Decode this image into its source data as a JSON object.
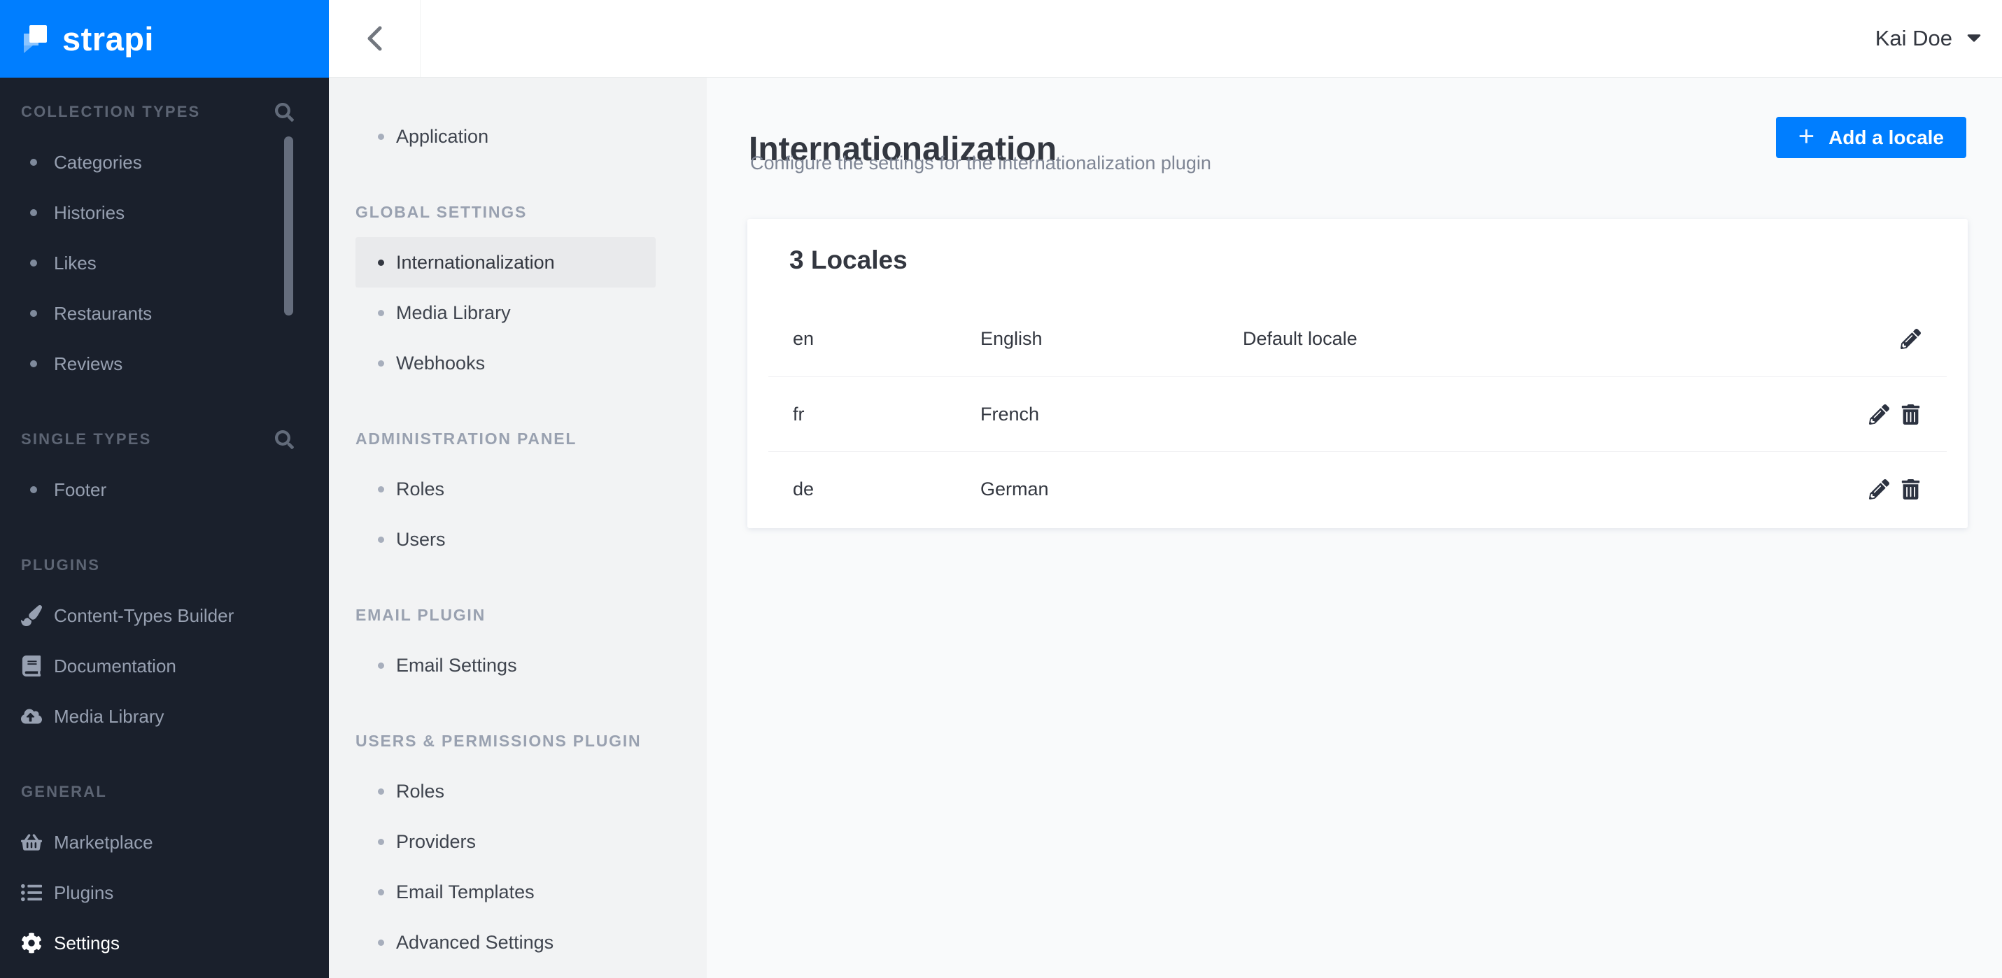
{
  "brand": {
    "name": "strapi"
  },
  "colors": {
    "accent": "#007eff",
    "sidebar_bg": "#1a202c",
    "subnav_bg": "#f2f3f4",
    "subnav_active_bg": "#e9eaec",
    "main_bg": "#f9fafb",
    "text_dark": "#333740",
    "text_muted": "#7e8594"
  },
  "sidebar": {
    "sections": [
      {
        "label": "COLLECTION TYPES",
        "icon": "search-icon",
        "items": [
          {
            "label": "Categories",
            "icon": "bullet"
          },
          {
            "label": "Histories",
            "icon": "bullet"
          },
          {
            "label": "Likes",
            "icon": "bullet"
          },
          {
            "label": "Restaurants",
            "icon": "bullet"
          },
          {
            "label": "Reviews",
            "icon": "bullet"
          }
        ]
      },
      {
        "label": "SINGLE TYPES",
        "icon": "search-icon",
        "items": [
          {
            "label": "Footer",
            "icon": "bullet"
          }
        ]
      },
      {
        "label": "PLUGINS",
        "items": [
          {
            "label": "Content-Types Builder",
            "icon": "paintbrush-icon"
          },
          {
            "label": "Documentation",
            "icon": "book-icon"
          },
          {
            "label": "Media Library",
            "icon": "cloud-upload-icon"
          }
        ]
      },
      {
        "label": "GENERAL",
        "items": [
          {
            "label": "Marketplace",
            "icon": "basket-icon"
          },
          {
            "label": "Plugins",
            "icon": "list-icon"
          },
          {
            "label": "Settings",
            "icon": "gear-icon",
            "active": true
          }
        ]
      }
    ]
  },
  "topbar": {
    "back_icon": "chevron-left-icon",
    "user": {
      "name": "Kai Doe",
      "menu_icon": "caret-down-icon"
    }
  },
  "subnav": {
    "standalone": [
      {
        "label": "Application"
      }
    ],
    "sections": [
      {
        "label": "GLOBAL SETTINGS",
        "items": [
          {
            "label": "Internationalization",
            "active": true
          },
          {
            "label": "Media Library"
          },
          {
            "label": "Webhooks"
          }
        ]
      },
      {
        "label": "ADMINISTRATION PANEL",
        "items": [
          {
            "label": "Roles"
          },
          {
            "label": "Users"
          }
        ]
      },
      {
        "label": "EMAIL PLUGIN",
        "items": [
          {
            "label": "Email Settings"
          }
        ]
      },
      {
        "label": "USERS & PERMISSIONS PLUGIN",
        "items": [
          {
            "label": "Roles"
          },
          {
            "label": "Providers"
          },
          {
            "label": "Email Templates"
          },
          {
            "label": "Advanced Settings"
          }
        ]
      }
    ]
  },
  "main": {
    "title": "Internationalization",
    "subtitle": "Configure the settings for the internationalization plugin",
    "add_button": {
      "plus": "+",
      "label": "Add a locale"
    },
    "card": {
      "title": "3 Locales",
      "rows": [
        {
          "code": "en",
          "name": "English",
          "badge": "Default locale",
          "actions": [
            "edit"
          ]
        },
        {
          "code": "fr",
          "name": "French",
          "badge": "",
          "actions": [
            "edit",
            "delete"
          ]
        },
        {
          "code": "de",
          "name": "German",
          "badge": "",
          "actions": [
            "edit",
            "delete"
          ]
        }
      ]
    }
  }
}
